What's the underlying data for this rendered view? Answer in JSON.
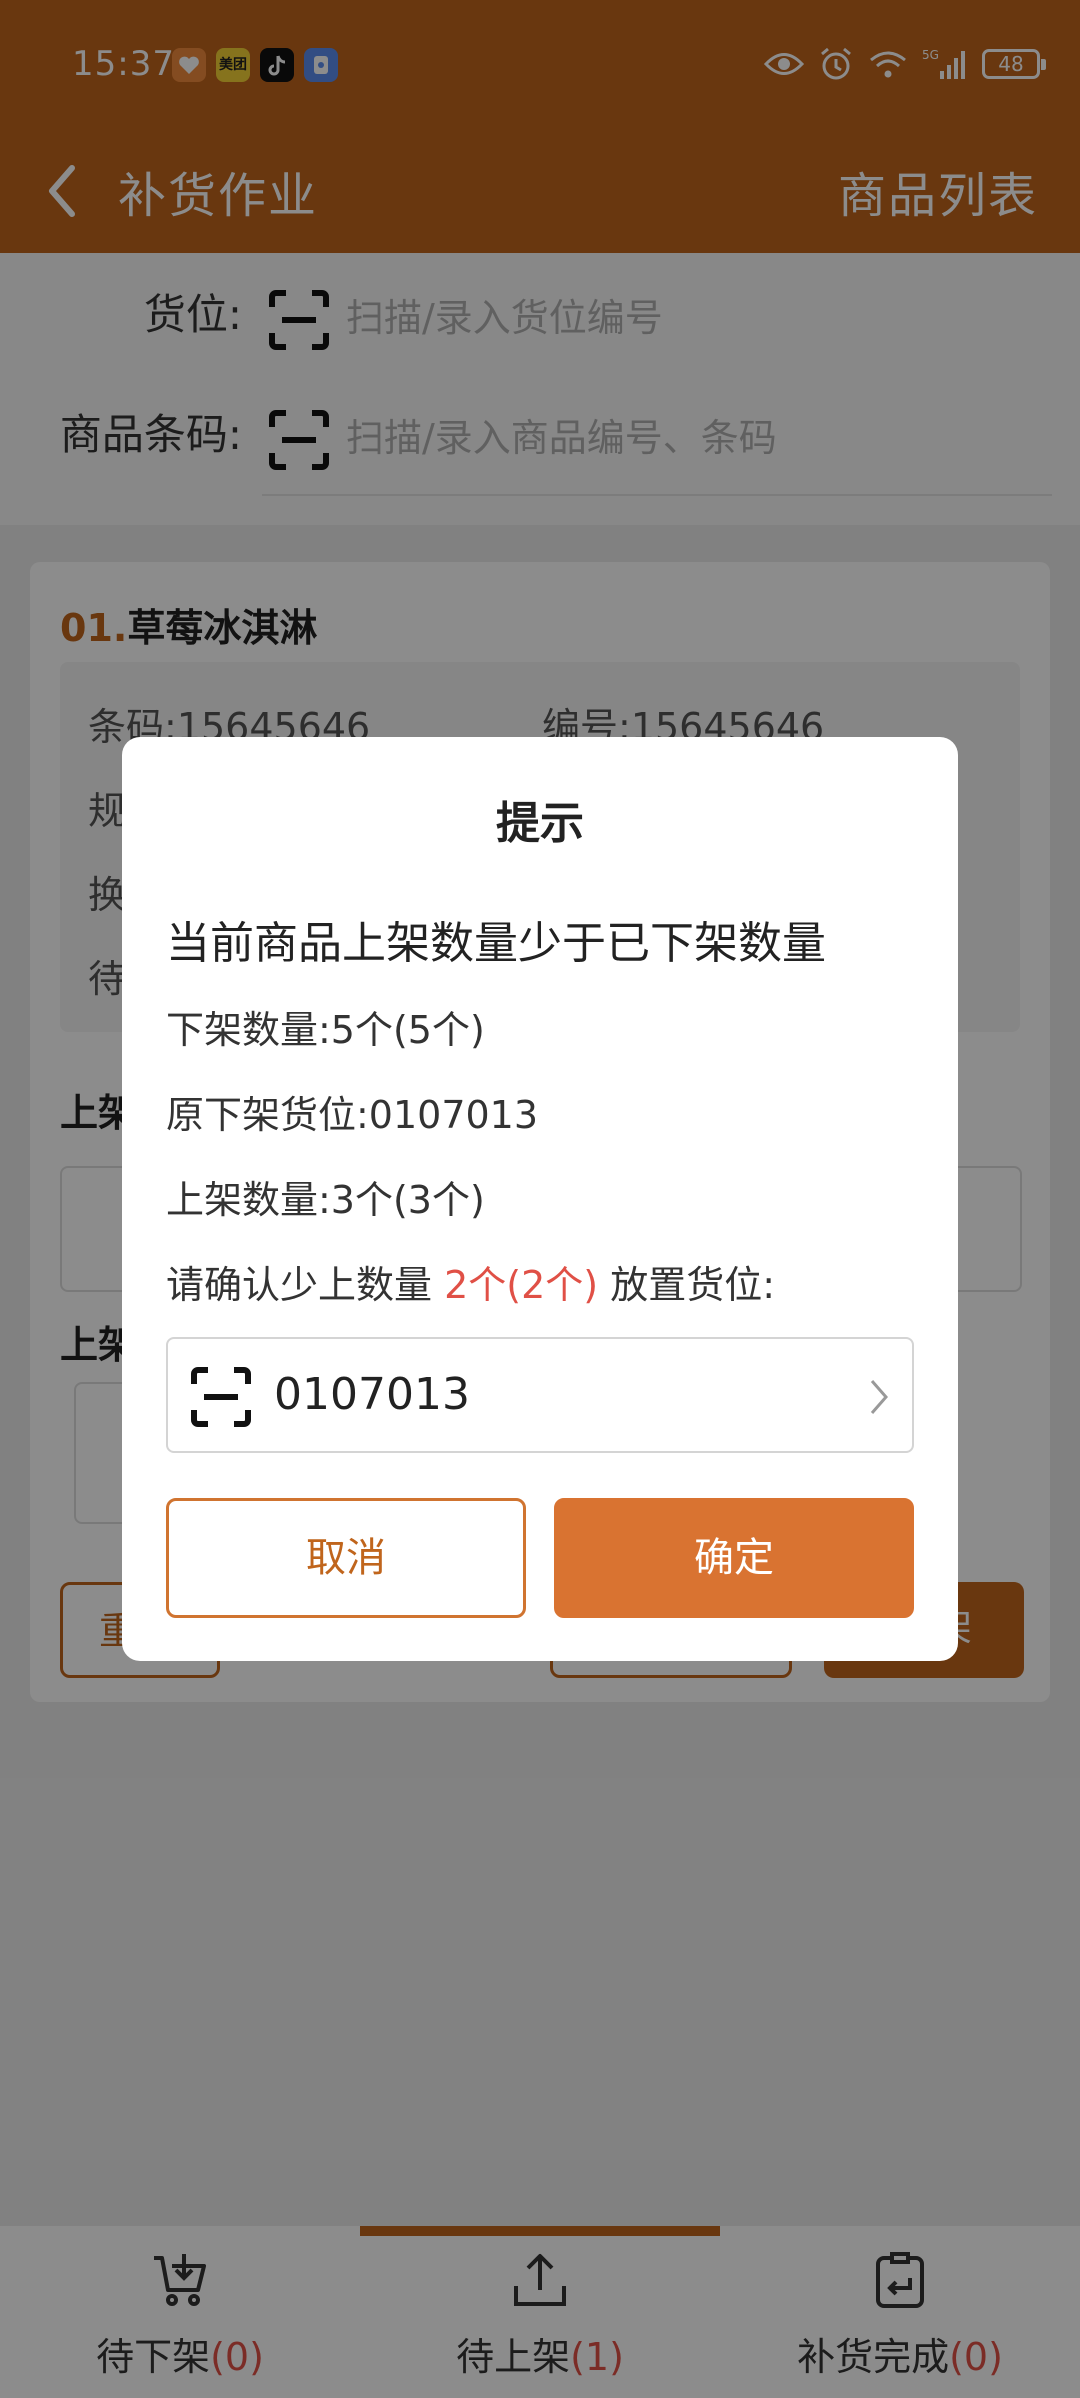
{
  "status_bar": {
    "time": "15:37",
    "apps": [
      {
        "icon": "heart-app-icon",
        "color": "#f08a3c",
        "label": ""
      },
      {
        "icon": "meituan-app-icon",
        "color": "#f5d235",
        "label": "美团"
      },
      {
        "icon": "tiktok-app-icon",
        "color": "#111111",
        "label": ""
      },
      {
        "icon": "shield-app-icon",
        "color": "#5b8def",
        "label": ""
      }
    ],
    "network": "5G",
    "battery": "48"
  },
  "header": {
    "back_icon": "chevron-left-icon",
    "title": "补货作业",
    "right_link": "商品列表"
  },
  "form": {
    "location": {
      "label": "货位:",
      "placeholder": "扫描/录入货位编号"
    },
    "barcode": {
      "label": "商品条码:",
      "placeholder": "扫描/录入商品编号、条码"
    }
  },
  "card": {
    "index": "01.",
    "name": "草莓冰淇淋",
    "barcode_label": "条码:",
    "barcode_value": "15645646",
    "code_label": "编号:",
    "code_value": "15645646",
    "row2_partial": "规",
    "row3_partial": "换",
    "row4_partial": "待",
    "section1_partial": "上架",
    "section2_partial": "上架",
    "btn_reset_partial": "重",
    "btn_submit_partial": "架"
  },
  "dialog": {
    "title": "提示",
    "message": "当前商品上架数量少于已下架数量",
    "down_qty": "下架数量:5个(5个)",
    "orig_location": "原下架货位:0107013",
    "up_qty": "上架数量:3个(3个)",
    "confirm_prefix": "请确认少上数量",
    "confirm_diff": "2个(2个)",
    "confirm_suffix": "放置货位:",
    "location_value": "0107013",
    "cancel_label": "取消",
    "ok_label": "确定"
  },
  "tabs": [
    {
      "icon": "cart-download-icon",
      "label": "待下架",
      "count": "(0)"
    },
    {
      "icon": "upload-icon",
      "label": "待上架",
      "count": "(1)"
    },
    {
      "icon": "clipboard-return-icon",
      "label": "补货完成",
      "count": "(0)"
    }
  ],
  "colors": {
    "brand": "#c0651c",
    "confirm_button": "#d97331",
    "highlight_red": "#e05046"
  }
}
